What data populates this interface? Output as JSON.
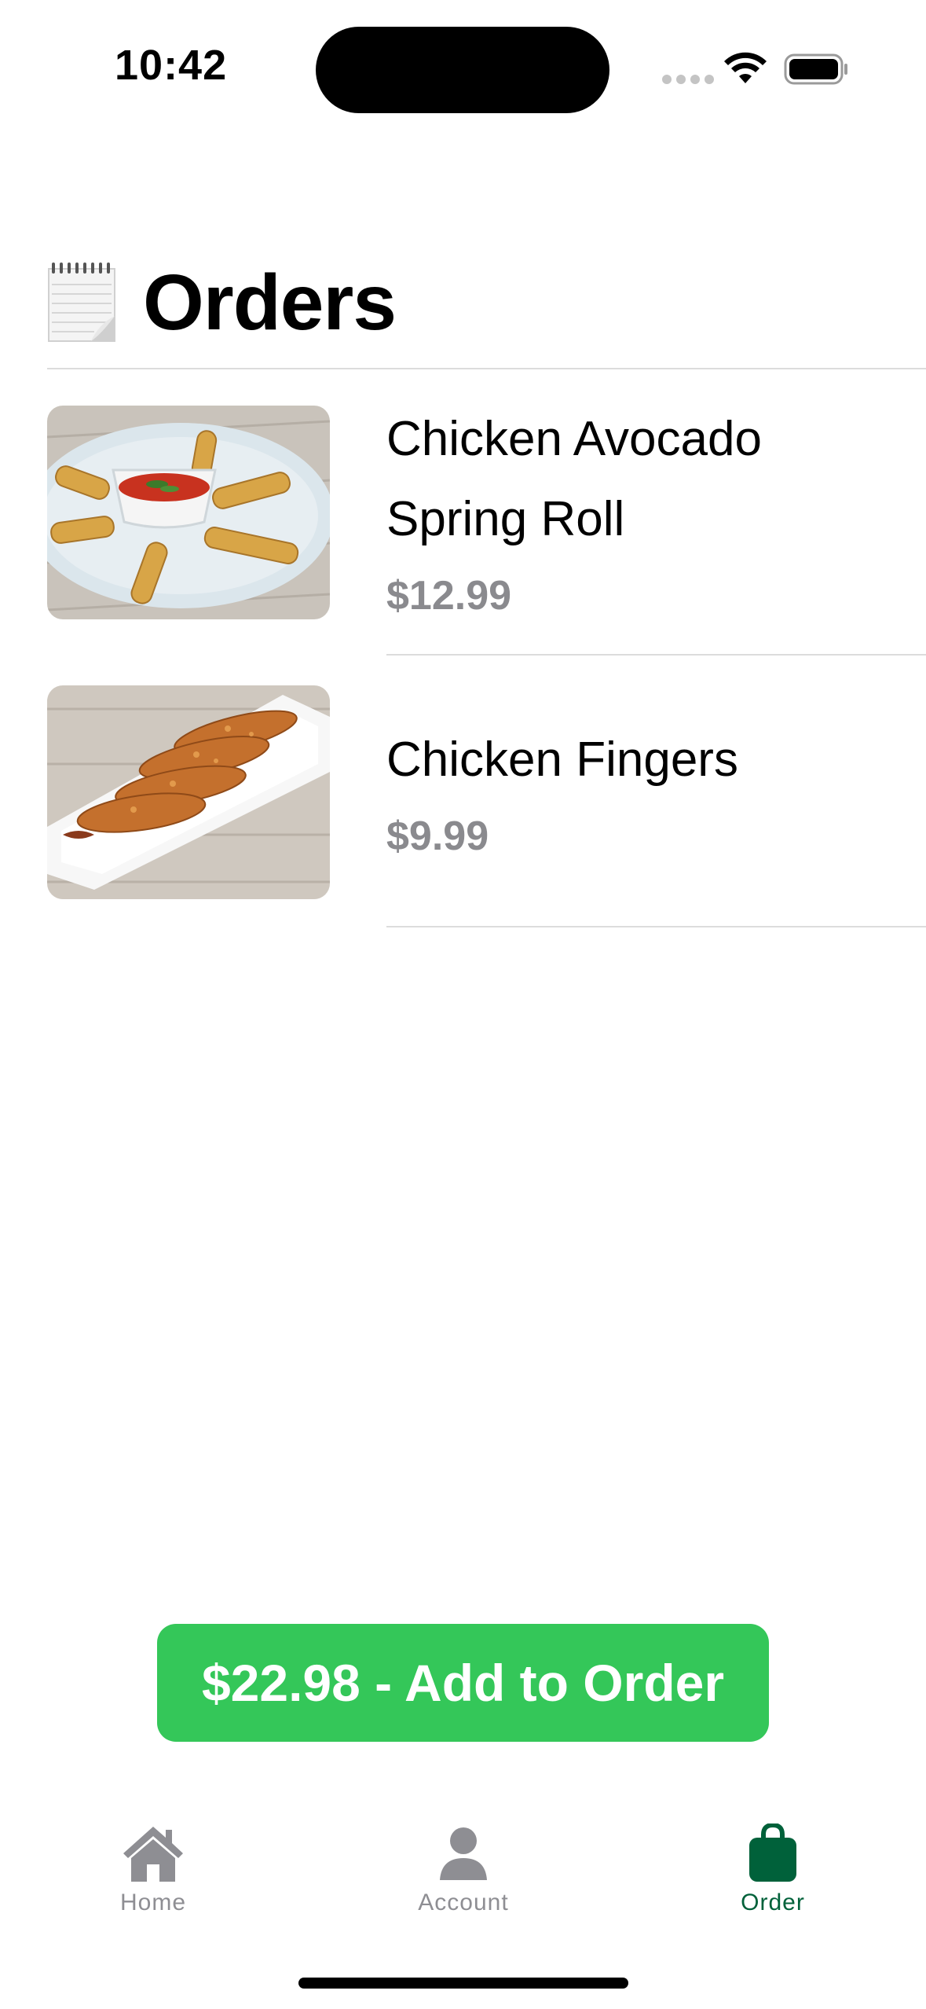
{
  "status_bar": {
    "time": "10:42"
  },
  "header": {
    "icon": "notepad-icon",
    "title": "Orders"
  },
  "orders": [
    {
      "name_line1": "Chicken Avocado",
      "name_line2": "Spring Roll",
      "price": "$12.99",
      "image": "spring-rolls-image"
    },
    {
      "name": "Chicken Fingers",
      "price": "$9.99",
      "image": "chicken-fingers-image"
    }
  ],
  "cta": {
    "label": "$22.98 - Add to Order",
    "color": "#34c759"
  },
  "tab_bar": {
    "tabs": [
      {
        "label": "Home",
        "icon": "house-icon",
        "active": false
      },
      {
        "label": "Account",
        "icon": "person-icon",
        "active": false
      },
      {
        "label": "Order",
        "icon": "bag-icon",
        "active": true
      }
    ],
    "active_color": "#00613a",
    "inactive_color": "#8e8e93"
  }
}
